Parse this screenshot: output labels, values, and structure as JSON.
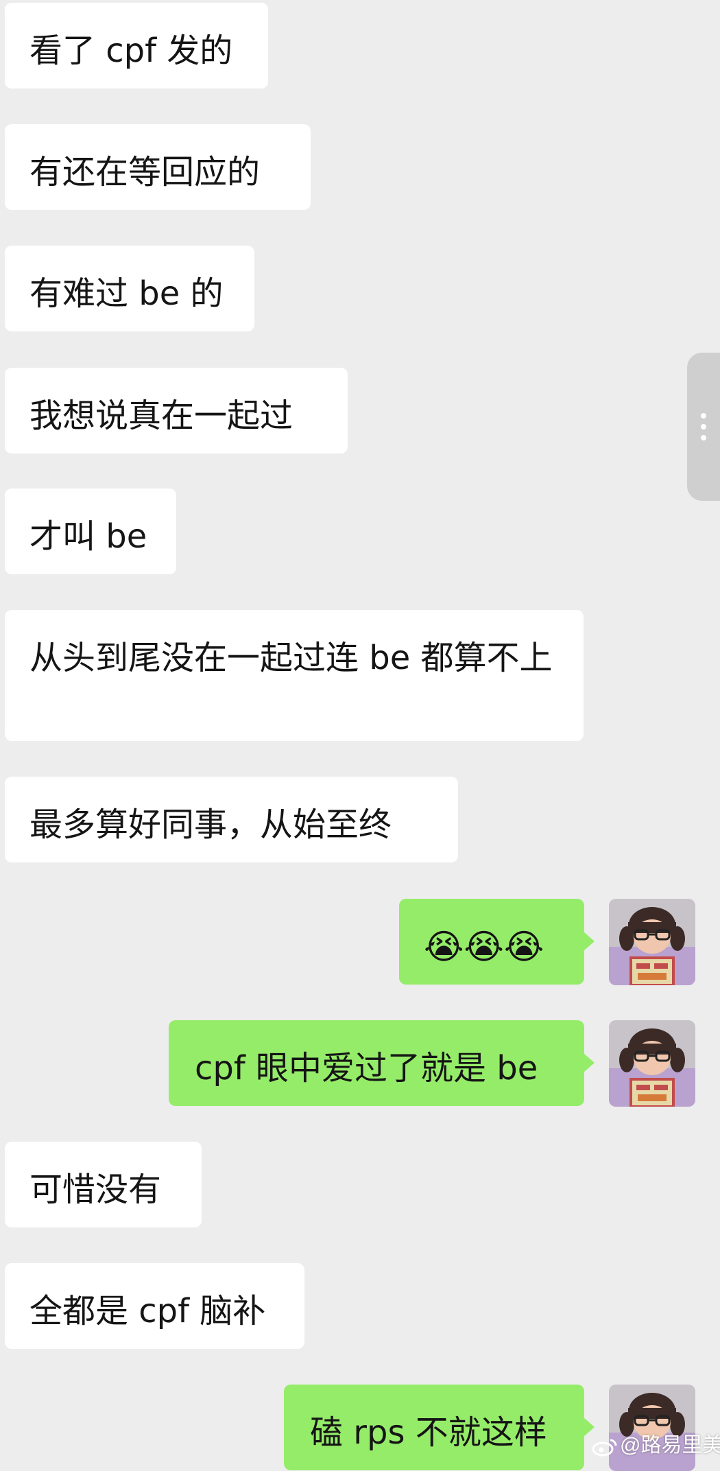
{
  "messages": [
    {
      "side": "in",
      "text": "看了 cpf 发的"
    },
    {
      "side": "in",
      "text": "有还在等回应的"
    },
    {
      "side": "in",
      "text": "有难过 be 的"
    },
    {
      "side": "in",
      "text": "我想说真在一起过"
    },
    {
      "side": "in",
      "text": "才叫 be"
    },
    {
      "side": "in",
      "text": "从头到尾没在一起过连 be 都算不上"
    },
    {
      "side": "in",
      "text": "最多算好同事，从始至终"
    },
    {
      "side": "out",
      "text": "😭😭😭"
    },
    {
      "side": "out",
      "text": "cpf 眼中爱过了就是 be"
    },
    {
      "side": "in",
      "text": "可惜没有"
    },
    {
      "side": "in",
      "text": "全都是 cpf 脑补"
    },
    {
      "side": "out",
      "text": "磕 rps 不就这样"
    }
  ],
  "watermark": {
    "text": "@路易里美",
    "icon": "weibo-icon"
  },
  "side_handle": {
    "icon": "more-vertical-icon"
  },
  "avatar": {
    "icon": "avatar-photo-child-glasses"
  },
  "colors": {
    "background": "#ededed",
    "incoming_bubble": "#ffffff",
    "outgoing_bubble": "#95ec69",
    "text": "#151515"
  }
}
